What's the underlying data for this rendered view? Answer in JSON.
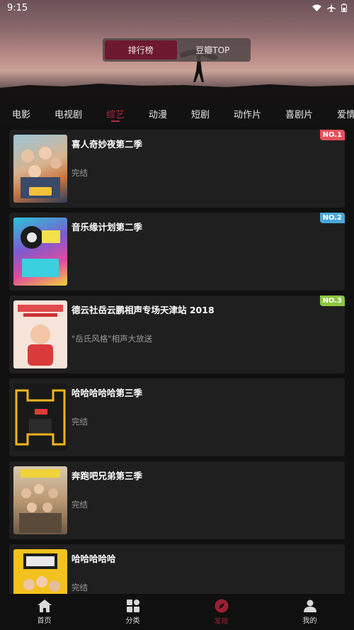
{
  "status": {
    "time": "9:15"
  },
  "segment": {
    "options": [
      "排行榜",
      "豆瓣TOP"
    ],
    "active": 0
  },
  "tabs": [
    "电影",
    "电视剧",
    "综艺",
    "动漫",
    "短剧",
    "动作片",
    "喜剧片",
    "爱情"
  ],
  "active_tab": 2,
  "items": [
    {
      "title": "喜人奇妙夜第二季",
      "subtitle": "完结",
      "rank": "NO.1",
      "rank_color": "#e8505b"
    },
    {
      "title": "音乐缘计划第二季",
      "subtitle": "",
      "rank": "NO.2",
      "rank_color": "#4aa8d8"
    },
    {
      "title": "德云社岳云鹏相声专场天津站 2018",
      "subtitle": "\"岳氏风格\"相声大放送",
      "rank": "NO.3",
      "rank_color": "#8cc63f"
    },
    {
      "title": "哈哈哈哈哈第三季",
      "subtitle": "完结",
      "rank": "",
      "rank_color": ""
    },
    {
      "title": "奔跑吧兄弟第三季",
      "subtitle": "完结",
      "rank": "",
      "rank_color": ""
    },
    {
      "title": "哈哈哈哈哈",
      "subtitle": "完结",
      "rank": "",
      "rank_color": ""
    }
  ],
  "nav": [
    {
      "label": "首页",
      "icon": "home-icon"
    },
    {
      "label": "分类",
      "icon": "grid-icon"
    },
    {
      "label": "发现",
      "icon": "compass-icon"
    },
    {
      "label": "我的",
      "icon": "user-icon"
    }
  ],
  "active_nav": 2
}
